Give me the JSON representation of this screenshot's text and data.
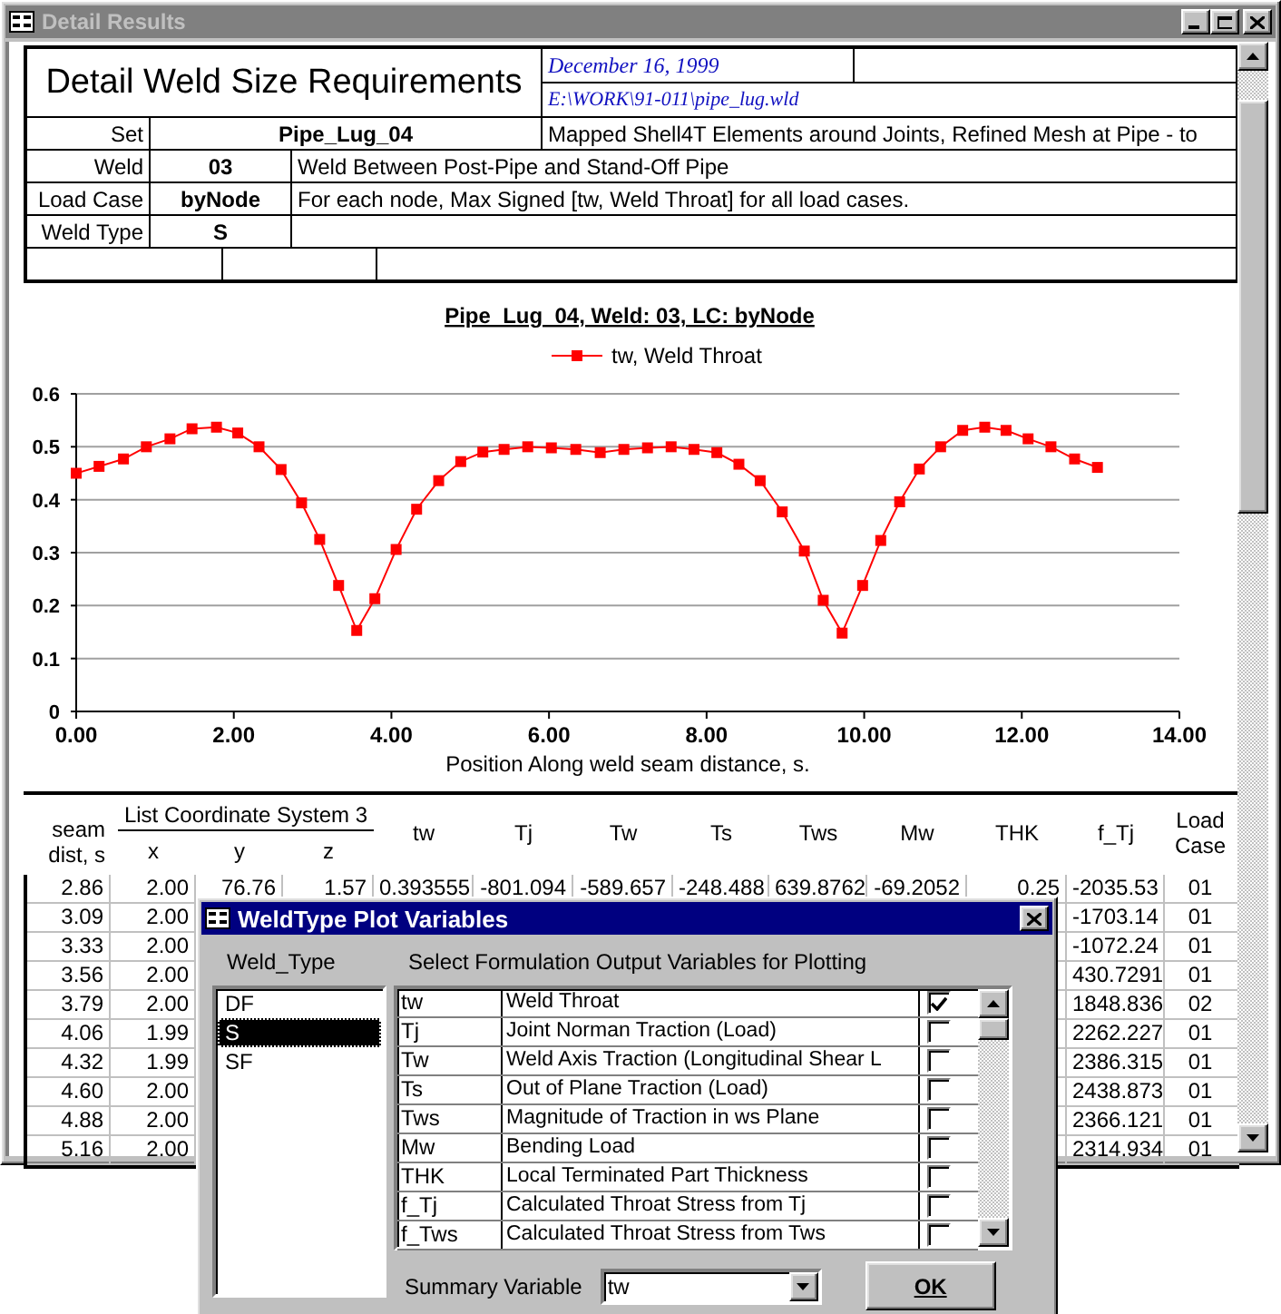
{
  "window": {
    "title": "Detail Results"
  },
  "report": {
    "title": "Detail Weld Size Requirements",
    "date": "December 16, 1999",
    "file_path": "E:\\WORK\\91-011\\pipe_lug.wld",
    "fields": [
      {
        "label": "Set",
        "value": "Pipe_Lug_04",
        "description": "Mapped Shell4T Elements around Joints, Refined Mesh at Pipe - to",
        "kind": "wide"
      },
      {
        "label": "Weld",
        "value": "03",
        "description": "Weld Between Post-Pipe and Stand-Off Pipe",
        "kind": "narrow"
      },
      {
        "label": "Load Case",
        "value": "byNode",
        "description": "For each node, Max Signed [tw, Weld Throat] for all load cases.",
        "kind": "narrow"
      },
      {
        "label": "Weld Type",
        "value": "S",
        "kind": "narrow"
      }
    ]
  },
  "chart": {
    "chart_data": {
      "type": "line",
      "title": "Pipe_Lug_04, Weld: 03, LC: byNode",
      "xlabel": "Position Along weld seam distance, s.",
      "x": [
        0,
        0.29,
        0.6,
        0.89,
        1.19,
        1.47,
        1.78,
        2.05,
        2.32,
        2.6,
        2.86,
        3.09,
        3.33,
        3.56,
        3.79,
        4.06,
        4.32,
        4.6,
        4.88,
        5.16,
        5.43,
        5.73,
        6.03,
        6.34,
        6.65,
        6.95,
        7.25,
        7.55,
        7.84,
        8.13,
        8.41,
        8.68,
        8.96,
        9.24,
        9.48,
        9.72,
        9.98,
        10.21,
        10.45,
        10.7,
        10.97,
        11.25,
        11.53,
        11.8,
        12.08,
        12.37,
        12.67,
        12.96
      ],
      "series": [
        {
          "name": "tw, Weld Throat",
          "color": "#ff0000",
          "marker": "square",
          "values": [
            0.45,
            0.463,
            0.477,
            0.5,
            0.515,
            0.534,
            0.537,
            0.526,
            0.5,
            0.457,
            0.394,
            0.325,
            0.238,
            0.153,
            0.213,
            0.306,
            0.382,
            0.436,
            0.472,
            0.49,
            0.495,
            0.5,
            0.498,
            0.495,
            0.489,
            0.495,
            0.498,
            0.5,
            0.495,
            0.489,
            0.467,
            0.436,
            0.377,
            0.303,
            0.21,
            0.148,
            0.238,
            0.323,
            0.396,
            0.458,
            0.5,
            0.531,
            0.537,
            0.531,
            0.515,
            0.5,
            0.477,
            0.461
          ]
        }
      ],
      "xlim": [
        0,
        14
      ],
      "ylim": [
        0,
        0.6
      ],
      "grid": true,
      "xticks": [
        {
          "value": 0,
          "label": "0.00"
        },
        {
          "value": 2,
          "label": "2.00"
        },
        {
          "value": 4,
          "label": "4.00"
        },
        {
          "value": 6,
          "label": "6.00"
        },
        {
          "value": 8,
          "label": "8.00"
        },
        {
          "value": 10,
          "label": "10.00"
        },
        {
          "value": 12,
          "label": "12.00"
        },
        {
          "value": 14,
          "label": "14.00"
        }
      ],
      "yticks": [
        0,
        0.1,
        0.2,
        0.3,
        0.4,
        0.5,
        0.6
      ]
    }
  },
  "table": {
    "column_group": "List Coordinate System 3",
    "columns": [
      {
        "label": "seam dist, s",
        "grouped": false
      },
      {
        "label": "x",
        "grouped": true
      },
      {
        "label": "y",
        "grouped": true
      },
      {
        "label": "z",
        "grouped": true
      },
      {
        "label": "tw",
        "grouped": false
      },
      {
        "label": "Tj",
        "grouped": false
      },
      {
        "label": "Tw",
        "grouped": false
      },
      {
        "label": "Ts",
        "grouped": false
      },
      {
        "label": "Tws",
        "grouped": false
      },
      {
        "label": "Mw",
        "grouped": false
      },
      {
        "label": "THK",
        "grouped": false
      },
      {
        "label": "f_Tj",
        "grouped": false
      },
      {
        "label": "Load Case",
        "grouped": false
      }
    ],
    "rows": [
      {
        "cells": [
          "2.86",
          "2.00",
          "76.76",
          "1.57",
          "0.393555",
          "-801.094",
          "-589.657",
          "-248.488",
          "639.8762",
          "-69.2052",
          "0.25",
          "-2035.53",
          "01"
        ]
      },
      {
        "cells": [
          "3.09",
          "2.00"
        ],
        "end_cells": [
          "-1703.14",
          "01"
        ]
      },
      {
        "cells": [
          "3.33",
          "2.00"
        ],
        "end_cells": [
          "-1072.24",
          "01"
        ]
      },
      {
        "cells": [
          "3.56",
          "2.00"
        ],
        "end_cells": [
          "430.7291",
          "01"
        ]
      },
      {
        "cells": [
          "3.79",
          "2.00"
        ],
        "end_cells": [
          "1848.836",
          "02"
        ]
      },
      {
        "cells": [
          "4.06",
          "1.99"
        ],
        "end_cells": [
          "2262.227",
          "01"
        ]
      },
      {
        "cells": [
          "4.32",
          "1.99"
        ],
        "end_cells": [
          "2386.315",
          "01"
        ]
      },
      {
        "cells": [
          "4.60",
          "2.00"
        ],
        "end_cells": [
          "2438.873",
          "01"
        ]
      },
      {
        "cells": [
          "4.88",
          "2.00"
        ],
        "end_cells": [
          "2366.121",
          "01"
        ]
      },
      {
        "cells": [
          "5.16",
          "2.00"
        ],
        "end_cells": [
          "2314.934",
          "01"
        ]
      }
    ]
  },
  "dialog": {
    "title": "WeldType Plot Variables",
    "weld_type_label": "Weld_Type",
    "weld_types": [
      {
        "label": "DF",
        "selected": false
      },
      {
        "label": "S",
        "selected": true
      },
      {
        "label": "SF",
        "selected": false
      }
    ],
    "variables_label": "Select Formulation Output Variables for Plotting",
    "variables": [
      {
        "name": "tw",
        "description": "Weld Throat",
        "checked": true
      },
      {
        "name": "Tj",
        "description": "Joint Norman Traction (Load)",
        "checked": false
      },
      {
        "name": "Tw",
        "description": "Weld Axis Traction (Longitudinal Shear L",
        "checked": false
      },
      {
        "name": "Ts",
        "description": "Out of Plane Traction (Load)",
        "checked": false
      },
      {
        "name": "Tws",
        "description": "Magnitude of Traction in ws Plane",
        "checked": false
      },
      {
        "name": "Mw",
        "description": "Bending Load",
        "checked": false
      },
      {
        "name": "THK",
        "description": "Local Terminated Part Thickness",
        "checked": false
      },
      {
        "name": "f_Tj",
        "description": "Calculated Throat Stress from Tj",
        "checked": false
      },
      {
        "name": "f_Tws",
        "description": "Calculated Throat Stress from Tws",
        "checked": false
      }
    ],
    "summary_label": "Summary Variable",
    "summary_value": "tw",
    "ok_button": "OK"
  }
}
